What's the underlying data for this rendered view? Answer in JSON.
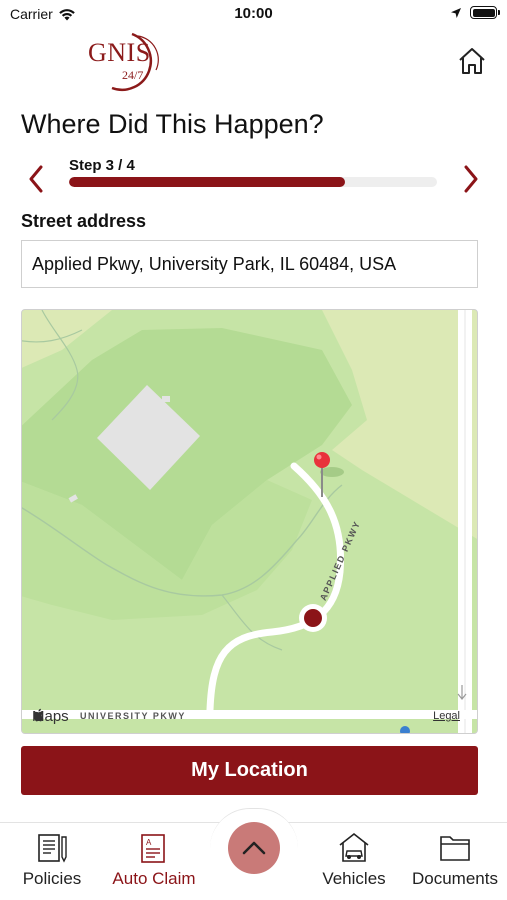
{
  "status_bar": {
    "carrier": "Carrier",
    "time": "10:00"
  },
  "header": {
    "logo_text": "GNIS",
    "logo_sub": "24/7",
    "brand_color": "#8b1418"
  },
  "page": {
    "title": "Where Did This Happen?"
  },
  "stepper": {
    "label": "Step 3 / 4",
    "current": 3,
    "total": 4,
    "progress_fraction": 0.75
  },
  "address": {
    "label": "Street address",
    "value": "Applied Pkwy, University Park, IL 60484, USA"
  },
  "map": {
    "brand": "Maps",
    "legal": "Legal",
    "street_1": "APPLIED PKWY",
    "street_2": "UNIVERSITY PKWY"
  },
  "actions": {
    "my_location": "My Location"
  },
  "tabs": [
    {
      "label": "Policies",
      "icon": "policies-icon",
      "active": false
    },
    {
      "label": "Auto Claim",
      "icon": "auto-claim-icon",
      "active": true
    },
    {
      "label": "Vehicles",
      "icon": "vehicles-icon",
      "active": false
    },
    {
      "label": "Documents",
      "icon": "documents-icon",
      "active": false
    }
  ]
}
